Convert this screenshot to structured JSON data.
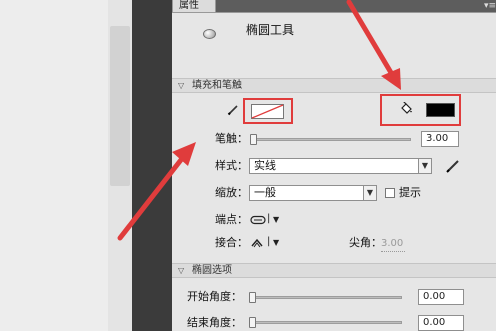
{
  "panel": {
    "tab_label": "属性",
    "menu_glyph": "▾≡",
    "tool_name": "椭圆工具"
  },
  "fill_stroke": {
    "section_title": "填充和笔触",
    "stroke_label": "笔触：",
    "stroke_value": "3.00",
    "style_label": "样式：",
    "style_value": "实线",
    "scale_label": "缩放：",
    "scale_value": "一般",
    "hint_label": "提示",
    "cap_label": "端点：",
    "join_label": "接合：",
    "miter_label": "尖角：",
    "miter_value": "3.00"
  },
  "ellipse_options": {
    "section_title": "椭圆选项",
    "start_label": "开始角度：",
    "start_value": "0.00",
    "end_label": "结束角度：",
    "end_value": "0.00"
  },
  "colors": {
    "fill_swatch": "#000000",
    "annotation": "#e03c3c"
  },
  "icons": {
    "stroke_color": "pencil-icon",
    "fill_color": "paint-bucket-icon",
    "tool": "ellipse-icon",
    "cap": "cap-round-icon",
    "join": "join-round-icon",
    "edit_style": "pencil-edit-icon"
  }
}
